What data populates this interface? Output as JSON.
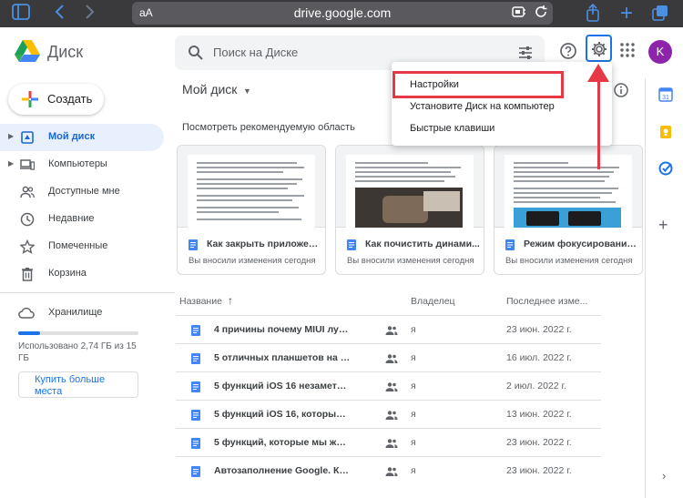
{
  "browser": {
    "aa_label": "aA",
    "url": "drive.google.com"
  },
  "header": {
    "app_name": "Диск",
    "search_placeholder": "Поиск на Диске",
    "avatar_letter": "K"
  },
  "sidebar": {
    "create_label": "Создать",
    "items": [
      {
        "label": "Мой диск",
        "icon": "my-drive-icon",
        "active": true
      },
      {
        "label": "Компьютеры",
        "icon": "computers-icon",
        "active": false
      },
      {
        "label": "Доступные мне",
        "icon": "shared-icon",
        "active": false
      },
      {
        "label": "Недавние",
        "icon": "clock-icon",
        "active": false
      },
      {
        "label": "Помеченные",
        "icon": "star-icon",
        "active": false
      },
      {
        "label": "Корзина",
        "icon": "trash-icon",
        "active": false
      }
    ],
    "storage_label": "Хранилище",
    "storage_used_text": "Использовано 2,74 ГБ из 15 ГБ",
    "storage_fraction": 0.18,
    "buy_label": "Купить больше места"
  },
  "main": {
    "title": "Мой диск",
    "suggested_title": "Посмотреть рекомендуемую область",
    "cards": [
      {
        "title": "Как закрыть приложен...",
        "subtitle": "Вы вносили изменения сегодня"
      },
      {
        "title": "Как почистить динами...",
        "subtitle": "Вы вносили изменения сегодня"
      },
      {
        "title": "Режим фокусирования ...",
        "subtitle": "Вы вносили изменения сегодня"
      }
    ],
    "columns": {
      "name": "Название",
      "sort_arrow": "↑",
      "owner": "Владелец",
      "modified": "Последнее изме..."
    },
    "rows": [
      {
        "name": "4 причины почему MIUI лучше конкур...",
        "owner": "я",
        "date": "23 июн. 2022 г."
      },
      {
        "name": "5 отличных планшетов на Андроид, к...",
        "owner": "я",
        "date": "16 июл. 2022 г."
      },
      {
        "name": "5 функций iOS 16 незаметных с перв...",
        "owner": "я",
        "date": "2 июл. 2022 г."
      },
      {
        "name": "5 функций iOS 16, которые давно ест...",
        "owner": "я",
        "date": "13 июн. 2022 г."
      },
      {
        "name": "5 функций, которые мы ждем от iPad ...",
        "owner": "я",
        "date": "23 июн. 2022 г."
      },
      {
        "name": "Автозаполнение Google. Как посмотр...",
        "owner": "я",
        "date": "23 июн. 2022 г."
      }
    ]
  },
  "dropdown": {
    "items": [
      "Настройки",
      "Установите Диск на компьютер",
      "Быстрые клавиши"
    ]
  },
  "side_panel": {
    "calendar_day": "31",
    "plus": "+",
    "chevron": "›"
  },
  "colors": {
    "accent": "#1a73e8",
    "highlight": "#e53946",
    "active_bg": "#e8f0fe"
  }
}
